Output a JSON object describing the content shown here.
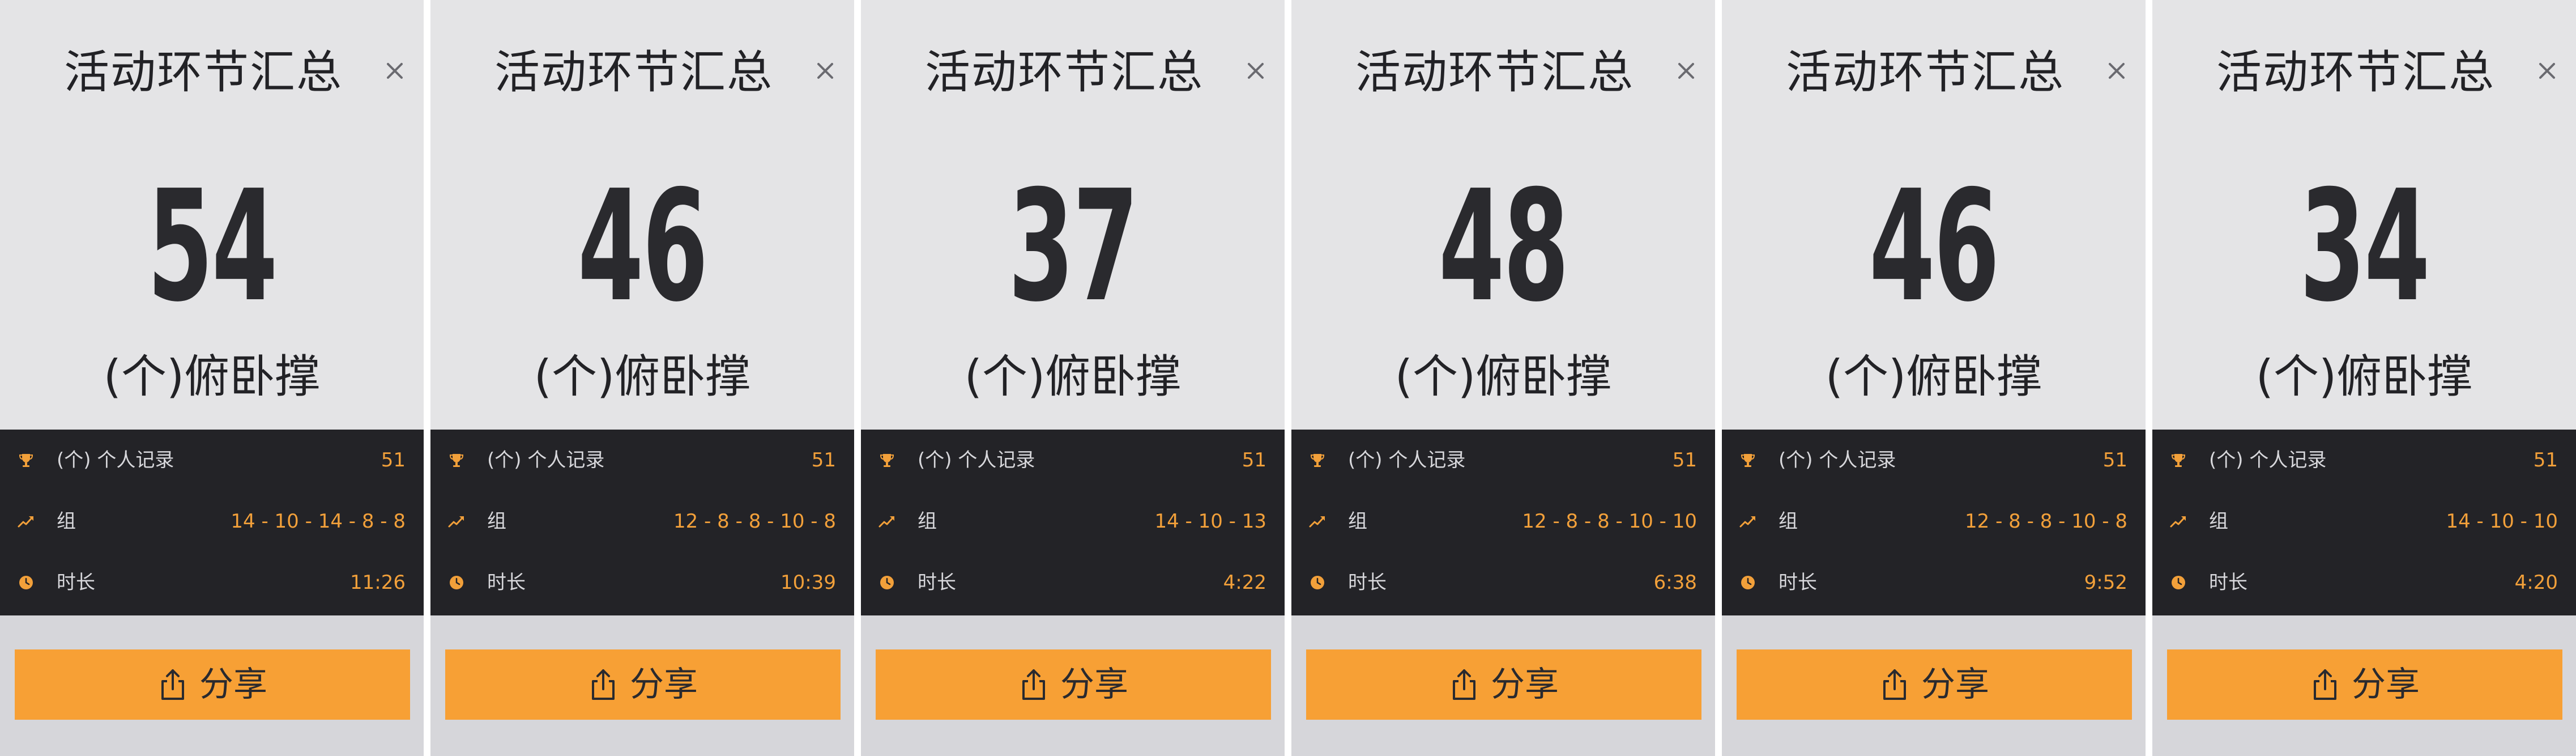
{
  "colors": {
    "accent": "#f7a035",
    "value_text": "#f2a03a",
    "stats_background": "#232327",
    "top_background": "#e4e4e6",
    "bottom_background": "#d6d6da",
    "main_text": "#222226"
  },
  "icons": {
    "close": "close-icon",
    "record": "trophy-icon",
    "sets": "trend-up-icon",
    "duration": "clock-icon",
    "share": "share-icon"
  },
  "panels": [
    {
      "title": "活动环节汇总",
      "count": "54",
      "exercise": "(个)俯卧撑",
      "record_label": "(个) 个人记录",
      "record_value": "51",
      "sets_label": "组",
      "sets_value": "14 - 10 - 14 - 8 - 8",
      "duration_label": "时长",
      "duration_value": "11:26",
      "share_label": "分享"
    },
    {
      "title": "活动环节汇总",
      "count": "46",
      "exercise": "(个)俯卧撑",
      "record_label": "(个) 个人记录",
      "record_value": "51",
      "sets_label": "组",
      "sets_value": "12 - 8 - 8 - 10 - 8",
      "duration_label": "时长",
      "duration_value": "10:39",
      "share_label": "分享"
    },
    {
      "title": "活动环节汇总",
      "count": "37",
      "exercise": "(个)俯卧撑",
      "record_label": "(个) 个人记录",
      "record_value": "51",
      "sets_label": "组",
      "sets_value": "14 - 10 - 13",
      "duration_label": "时长",
      "duration_value": "4:22",
      "share_label": "分享"
    },
    {
      "title": "活动环节汇总",
      "count": "48",
      "exercise": "(个)俯卧撑",
      "record_label": "(个) 个人记录",
      "record_value": "51",
      "sets_label": "组",
      "sets_value": "12 - 8 - 8 - 10 - 10",
      "duration_label": "时长",
      "duration_value": "6:38",
      "share_label": "分享"
    },
    {
      "title": "活动环节汇总",
      "count": "46",
      "exercise": "(个)俯卧撑",
      "record_label": "(个) 个人记录",
      "record_value": "51",
      "sets_label": "组",
      "sets_value": "12 - 8 - 8 - 10 - 8",
      "duration_label": "时长",
      "duration_value": "9:52",
      "share_label": "分享"
    },
    {
      "title": "活动环节汇总",
      "count": "34",
      "exercise": "(个)俯卧撑",
      "record_label": "(个) 个人记录",
      "record_value": "51",
      "sets_label": "组",
      "sets_value": "14 - 10 - 10",
      "duration_label": "时长",
      "duration_value": "4:20",
      "share_label": "分享"
    }
  ]
}
